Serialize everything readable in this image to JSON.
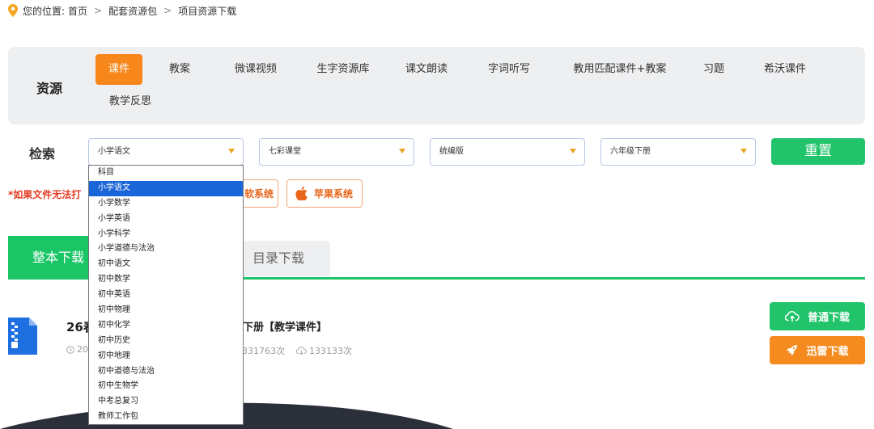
{
  "breadcrumb": {
    "prefix": "您的位置:",
    "items": [
      "首页",
      "配套资源包",
      "项目资源下载"
    ]
  },
  "resources": {
    "title": "资源",
    "tabs": [
      {
        "label": "课件",
        "active": true
      },
      {
        "label": "教案",
        "active": false
      },
      {
        "label": "微课视频",
        "active": false
      },
      {
        "label": "生字资源库",
        "active": false
      },
      {
        "label": "课文朗读",
        "active": false
      },
      {
        "label": "字词听写",
        "active": false
      },
      {
        "label": "教用匹配课件+教案",
        "active": false
      },
      {
        "label": "习题",
        "active": false
      },
      {
        "label": "希沃课件",
        "active": false
      },
      {
        "label": "教学反思",
        "active": false
      }
    ]
  },
  "search": {
    "label": "检索",
    "selects": [
      "小学语文",
      "七彩课堂",
      "统编版",
      "六年级下册"
    ],
    "reset_label": "重置"
  },
  "notice": {
    "text": "*如果文件无法打",
    "windows_label": "软系统",
    "apple_label": "苹果系统"
  },
  "download_tabs": {
    "main": "整本下载",
    "directory": "目录下载"
  },
  "file": {
    "title_start": "26春",
    "title_end": "下册【教学课件】",
    "date_partial": "20",
    "views": "331763次",
    "downloads": "133133次",
    "normal_download": "普通下载",
    "thunder_download": "迅雷下载"
  },
  "dropdown": {
    "selected": "小学语文",
    "options": [
      "科目",
      "小学语文",
      "小学数学",
      "小学英语",
      "小学科学",
      "小学道德与法治",
      "初中语文",
      "初中数学",
      "初中英语",
      "初中物理",
      "初中化学",
      "初中历史",
      "初中地理",
      "初中道德与法治",
      "初中生物学",
      "中考总复习",
      "教师工作包"
    ]
  },
  "colors": {
    "accent_orange": "#f7861b",
    "accent_green": "#21c46a",
    "warning_red": "#e43b22",
    "selected_blue": "#1a66d8"
  }
}
